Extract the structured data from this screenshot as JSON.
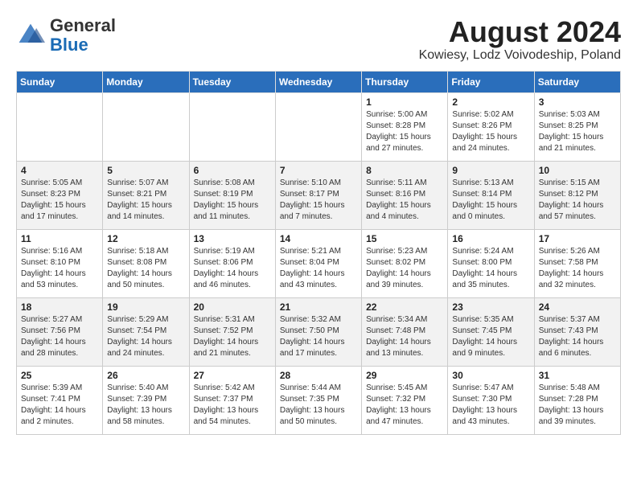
{
  "header": {
    "logo_general": "General",
    "logo_blue": "Blue",
    "title": "August 2024",
    "subtitle": "Kowiesy, Lodz Voivodeship, Poland"
  },
  "days_of_week": [
    "Sunday",
    "Monday",
    "Tuesday",
    "Wednesday",
    "Thursday",
    "Friday",
    "Saturday"
  ],
  "weeks": [
    [
      {
        "day": "",
        "info": ""
      },
      {
        "day": "",
        "info": ""
      },
      {
        "day": "",
        "info": ""
      },
      {
        "day": "",
        "info": ""
      },
      {
        "day": "1",
        "info": "Sunrise: 5:00 AM\nSunset: 8:28 PM\nDaylight: 15 hours\nand 27 minutes."
      },
      {
        "day": "2",
        "info": "Sunrise: 5:02 AM\nSunset: 8:26 PM\nDaylight: 15 hours\nand 24 minutes."
      },
      {
        "day": "3",
        "info": "Sunrise: 5:03 AM\nSunset: 8:25 PM\nDaylight: 15 hours\nand 21 minutes."
      }
    ],
    [
      {
        "day": "4",
        "info": "Sunrise: 5:05 AM\nSunset: 8:23 PM\nDaylight: 15 hours\nand 17 minutes."
      },
      {
        "day": "5",
        "info": "Sunrise: 5:07 AM\nSunset: 8:21 PM\nDaylight: 15 hours\nand 14 minutes."
      },
      {
        "day": "6",
        "info": "Sunrise: 5:08 AM\nSunset: 8:19 PM\nDaylight: 15 hours\nand 11 minutes."
      },
      {
        "day": "7",
        "info": "Sunrise: 5:10 AM\nSunset: 8:17 PM\nDaylight: 15 hours\nand 7 minutes."
      },
      {
        "day": "8",
        "info": "Sunrise: 5:11 AM\nSunset: 8:16 PM\nDaylight: 15 hours\nand 4 minutes."
      },
      {
        "day": "9",
        "info": "Sunrise: 5:13 AM\nSunset: 8:14 PM\nDaylight: 15 hours\nand 0 minutes."
      },
      {
        "day": "10",
        "info": "Sunrise: 5:15 AM\nSunset: 8:12 PM\nDaylight: 14 hours\nand 57 minutes."
      }
    ],
    [
      {
        "day": "11",
        "info": "Sunrise: 5:16 AM\nSunset: 8:10 PM\nDaylight: 14 hours\nand 53 minutes."
      },
      {
        "day": "12",
        "info": "Sunrise: 5:18 AM\nSunset: 8:08 PM\nDaylight: 14 hours\nand 50 minutes."
      },
      {
        "day": "13",
        "info": "Sunrise: 5:19 AM\nSunset: 8:06 PM\nDaylight: 14 hours\nand 46 minutes."
      },
      {
        "day": "14",
        "info": "Sunrise: 5:21 AM\nSunset: 8:04 PM\nDaylight: 14 hours\nand 43 minutes."
      },
      {
        "day": "15",
        "info": "Sunrise: 5:23 AM\nSunset: 8:02 PM\nDaylight: 14 hours\nand 39 minutes."
      },
      {
        "day": "16",
        "info": "Sunrise: 5:24 AM\nSunset: 8:00 PM\nDaylight: 14 hours\nand 35 minutes."
      },
      {
        "day": "17",
        "info": "Sunrise: 5:26 AM\nSunset: 7:58 PM\nDaylight: 14 hours\nand 32 minutes."
      }
    ],
    [
      {
        "day": "18",
        "info": "Sunrise: 5:27 AM\nSunset: 7:56 PM\nDaylight: 14 hours\nand 28 minutes."
      },
      {
        "day": "19",
        "info": "Sunrise: 5:29 AM\nSunset: 7:54 PM\nDaylight: 14 hours\nand 24 minutes."
      },
      {
        "day": "20",
        "info": "Sunrise: 5:31 AM\nSunset: 7:52 PM\nDaylight: 14 hours\nand 21 minutes."
      },
      {
        "day": "21",
        "info": "Sunrise: 5:32 AM\nSunset: 7:50 PM\nDaylight: 14 hours\nand 17 minutes."
      },
      {
        "day": "22",
        "info": "Sunrise: 5:34 AM\nSunset: 7:48 PM\nDaylight: 14 hours\nand 13 minutes."
      },
      {
        "day": "23",
        "info": "Sunrise: 5:35 AM\nSunset: 7:45 PM\nDaylight: 14 hours\nand 9 minutes."
      },
      {
        "day": "24",
        "info": "Sunrise: 5:37 AM\nSunset: 7:43 PM\nDaylight: 14 hours\nand 6 minutes."
      }
    ],
    [
      {
        "day": "25",
        "info": "Sunrise: 5:39 AM\nSunset: 7:41 PM\nDaylight: 14 hours\nand 2 minutes."
      },
      {
        "day": "26",
        "info": "Sunrise: 5:40 AM\nSunset: 7:39 PM\nDaylight: 13 hours\nand 58 minutes."
      },
      {
        "day": "27",
        "info": "Sunrise: 5:42 AM\nSunset: 7:37 PM\nDaylight: 13 hours\nand 54 minutes."
      },
      {
        "day": "28",
        "info": "Sunrise: 5:44 AM\nSunset: 7:35 PM\nDaylight: 13 hours\nand 50 minutes."
      },
      {
        "day": "29",
        "info": "Sunrise: 5:45 AM\nSunset: 7:32 PM\nDaylight: 13 hours\nand 47 minutes."
      },
      {
        "day": "30",
        "info": "Sunrise: 5:47 AM\nSunset: 7:30 PM\nDaylight: 13 hours\nand 43 minutes."
      },
      {
        "day": "31",
        "info": "Sunrise: 5:48 AM\nSunset: 7:28 PM\nDaylight: 13 hours\nand 39 minutes."
      }
    ]
  ]
}
